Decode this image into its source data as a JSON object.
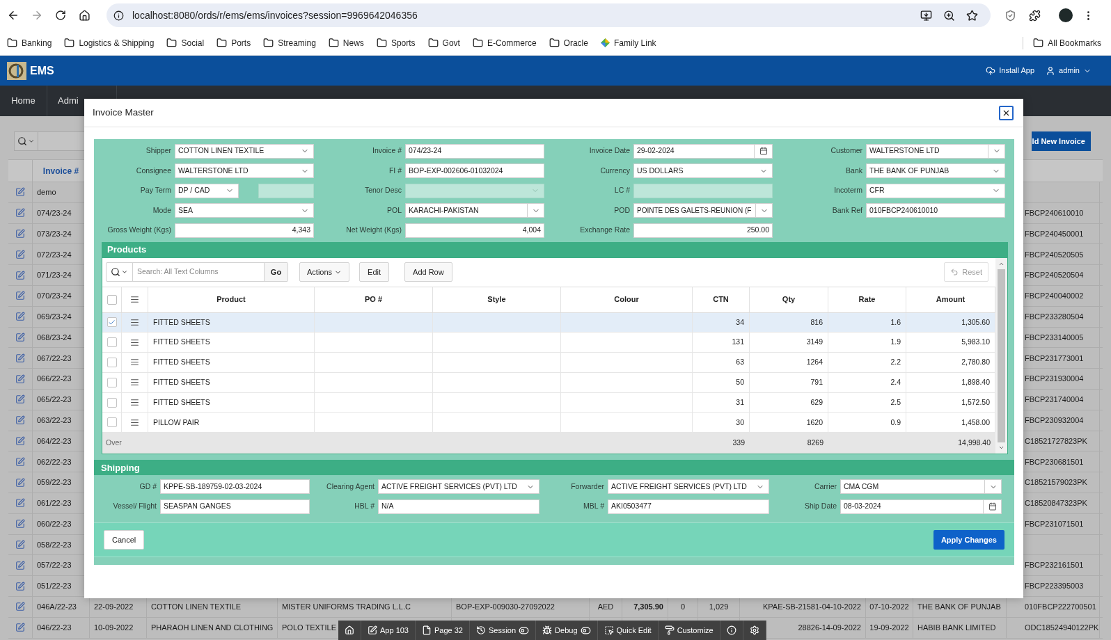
{
  "browser": {
    "url": "localhost:8080/ords/r/ems/ems/invoices?session=9969642046356",
    "bookmarks": [
      {
        "label": "Banking",
        "kind": "folder"
      },
      {
        "label": "Logistics & Shipping",
        "kind": "folder"
      },
      {
        "label": "Social",
        "kind": "folder"
      },
      {
        "label": "Ports",
        "kind": "folder"
      },
      {
        "label": "Streaming",
        "kind": "folder"
      },
      {
        "label": "News",
        "kind": "folder"
      },
      {
        "label": "Sports",
        "kind": "folder"
      },
      {
        "label": "Govt",
        "kind": "folder"
      },
      {
        "label": "E-Commerce",
        "kind": "folder"
      },
      {
        "label": "Oracle",
        "kind": "folder"
      },
      {
        "label": "Family Link",
        "kind": "link"
      }
    ],
    "all_bookmarks": "All Bookmarks"
  },
  "app_header": {
    "title": "EMS",
    "install": "Install App",
    "user": "admin"
  },
  "nav": {
    "items": [
      {
        "label": "Home"
      },
      {
        "label": "Admi"
      }
    ]
  },
  "page": {
    "add_button": "ld New Invoice",
    "table": {
      "header": "Invoice #",
      "rows": [
        {
          "invoice": "demo"
        },
        {
          "invoice": "074/23-24",
          "bank_ref": "FBCP240610010"
        },
        {
          "invoice": "073/23-24",
          "bank_ref": "FBCP240450001"
        },
        {
          "invoice": "072/23-24",
          "bank_ref": "FBCP240520505"
        },
        {
          "invoice": "071/23-24",
          "bank_ref": "FBCP240520504"
        },
        {
          "invoice": "070/23-24",
          "bank_ref": "FBCP240040002"
        },
        {
          "invoice": "069/23-24",
          "bank_ref": "FBCP233280504"
        },
        {
          "invoice": "068/23-24",
          "bank_ref": "FBCP233140005"
        },
        {
          "invoice": "067/22-23",
          "bank_ref": "FBCP231773001"
        },
        {
          "invoice": "066/22-23",
          "bank_ref": "FBCP231930004"
        },
        {
          "invoice": "065/22-23",
          "bank_ref": "FBCP231740004"
        },
        {
          "invoice": "063/22-23",
          "bank_ref": "FBCP230932004"
        },
        {
          "invoice": "064/22-23",
          "bank_ref": "C18521727823PK"
        },
        {
          "invoice": "062/22-23",
          "bank_ref": "FBCP230681501"
        },
        {
          "invoice": "059/22-23",
          "bank_ref": "C18521579023PK"
        },
        {
          "invoice": "061/22-23",
          "bank_ref": "C18520847323PK"
        },
        {
          "invoice": "060/22-23",
          "bank_ref": "FBCP231071501"
        },
        {
          "invoice": "058/22-23"
        },
        {
          "invoice": "057/22-23",
          "bank_ref": "FBCP232161501"
        },
        {
          "invoice": "051/22-23",
          "bank_ref": "FBCP223395003"
        },
        {
          "invoice": "046A/22-23",
          "date": "22-09-2022",
          "shipper": "COTTON LINEN TEXTILE",
          "consignee": "MISTER UNIFORMS TRADING L.L.C",
          "fi": "BOP-EXP-009030-27092022",
          "currency": "AED",
          "amount": "7,305.90",
          "column_8": "0",
          "column_9": "1,029",
          "gd": "KPAE-SB-21581-04-10-2022",
          "ship_date": "07-10-2022",
          "bank": "THE BANK OF PUNJAB",
          "bank_ref": "010FBCP222700501"
        },
        {
          "invoice": "046/22-23",
          "date": "10-09-2022",
          "shipper": "PHARAOH LINEN AND CLOTHING",
          "consignee": "POLO TEXTILE",
          "gd": "28826-14-09-2022",
          "ship_date": "19-09-2022",
          "bank": "HABIB BANK LIMITED",
          "bank_ref": "ODC18524940122PK"
        }
      ]
    }
  },
  "modal": {
    "title": "Invoice Master",
    "form": {
      "rows": [
        [
          {
            "label": "Shipper",
            "value": "COTTON LINEN TEXTILE",
            "kind": "select",
            "disabled": false
          },
          {
            "label": "Invoice #",
            "value": "074/23-24",
            "kind": "text",
            "disabled": false
          },
          {
            "label": "Invoice Date",
            "value": "29-02-2024",
            "kind": "date",
            "disabled": false
          },
          {
            "label": "Customer",
            "value": "WALTERSTONE LTD",
            "kind": "combo",
            "disabled": false
          }
        ],
        [
          {
            "label": "Consignee",
            "value": "WALTERSTONE LTD",
            "kind": "select",
            "disabled": false
          },
          {
            "label": "FI #",
            "value": "BOP-EXP-002606-01032024",
            "kind": "text",
            "disabled": false
          },
          {
            "label": "Currency",
            "value": "US DOLLARS",
            "kind": "select",
            "disabled": false
          },
          {
            "label": "Bank",
            "value": "THE BANK OF PUNJAB",
            "kind": "select",
            "disabled": false
          }
        ],
        [
          {
            "label": "Pay Term",
            "value": "DP / CAD",
            "kind": "select",
            "disabled": false,
            "extra_field": {
              "disabled": true
            }
          },
          {
            "label": "Tenor Desc",
            "kind": "select",
            "disabled": true
          },
          {
            "label": "LC #",
            "kind": "text",
            "disabled": true
          },
          {
            "label": "Incoterm",
            "value": "CFR",
            "kind": "select",
            "disabled": false
          }
        ],
        [
          {
            "label": "Mode",
            "value": "SEA",
            "kind": "select",
            "disabled": false
          },
          {
            "label": "POL",
            "value": "KARACHI-PAKISTAN",
            "kind": "combo",
            "disabled": false
          },
          {
            "label": "POD",
            "value": "POINTE DES GALETS-REUNION (F",
            "kind": "combo",
            "disabled": false
          },
          {
            "label": "Bank Ref",
            "value": "010FBCP240610010",
            "kind": "text",
            "disabled": false
          }
        ],
        [
          {
            "label": "Gross Weight (Kgs)",
            "value": "4,343",
            "kind": "number",
            "disabled": false
          },
          {
            "label": "Net Weight (Kgs)",
            "value": "4,004",
            "kind": "number",
            "disabled": false
          },
          {
            "label": "Exchange Rate",
            "value": "250.00",
            "kind": "number",
            "disabled": false
          }
        ]
      ]
    },
    "products": {
      "title": "Products",
      "search_placeholder": "Search: All Text Columns",
      "go": "Go",
      "actions": "Actions",
      "edit": "Edit",
      "add_row": "Add Row",
      "reset": "Reset",
      "all_selected": false,
      "columns": [
        "Product",
        "PO #",
        "Style",
        "Colour",
        "CTN",
        "Qty",
        "Rate",
        "Amount"
      ],
      "rows": [
        {
          "selected": true,
          "cells": [
            "FITTED SHEETS",
            null,
            null,
            null,
            "34",
            "816",
            "1.6",
            "1,305.60"
          ]
        },
        {
          "selected": false,
          "cells": [
            "FITTED SHEETS",
            null,
            null,
            null,
            "131",
            "3149",
            "1.9",
            "5,983.10"
          ]
        },
        {
          "selected": false,
          "cells": [
            "FITTED SHEETS",
            null,
            null,
            null,
            "63",
            "1264",
            "2.2",
            "2,780.80"
          ]
        },
        {
          "selected": false,
          "cells": [
            "FITTED SHEETS",
            null,
            null,
            null,
            "50",
            "791",
            "2.4",
            "1,898.40"
          ]
        },
        {
          "selected": false,
          "cells": [
            "FITTED SHEETS",
            null,
            null,
            null,
            "31",
            "629",
            "2.5",
            "1,572.50"
          ]
        },
        {
          "selected": false,
          "cells": [
            "PILLOW PAIR",
            null,
            null,
            null,
            "30",
            "1620",
            "0.9",
            "1,458.00"
          ]
        }
      ],
      "footer": {
        "label": "Over",
        "cells": [
          null,
          null,
          null,
          null,
          "339",
          "8269",
          null,
          "14,998.40"
        ]
      }
    },
    "shipping": {
      "title": "Shipping",
      "rows": [
        [
          {
            "label": "GD #",
            "value": "KPPE-SB-189759-02-03-2024",
            "kind": "text",
            "disabled": false
          },
          {
            "label": "Clearing Agent",
            "value": "ACTIVE FREIGHT SERVICES (PVT) LTD",
            "kind": "select",
            "disabled": false
          },
          {
            "label": "Forwarder",
            "value": "ACTIVE FREIGHT SERVICES (PVT) LTD",
            "kind": "select",
            "disabled": false
          },
          {
            "label": "Carrier",
            "value": "CMA CGM",
            "kind": "combo",
            "disabled": false
          }
        ],
        [
          {
            "label": "Vessel/ Flight",
            "value": "SEASPAN GANGES",
            "kind": "text",
            "disabled": false
          },
          {
            "label": "HBL #",
            "value": "N/A",
            "kind": "text",
            "disabled": false
          },
          {
            "label": "MBL #",
            "value": "AKI0503477",
            "kind": "text",
            "disabled": false
          },
          {
            "label": "Ship Date",
            "value": "08-03-2024",
            "kind": "date",
            "disabled": false
          }
        ]
      ]
    },
    "buttons": {
      "cancel": "Cancel",
      "apply": "Apply Changes"
    }
  },
  "dev_toolbar": [
    {
      "kind": "home",
      "toggle": false
    },
    {
      "kind": "app",
      "label": "App 103",
      "toggle": false
    },
    {
      "kind": "page",
      "label": "Page 32",
      "toggle": false
    },
    {
      "kind": "session",
      "label": "Session",
      "toggle": true
    },
    {
      "kind": "debug",
      "label": "Debug",
      "toggle": true
    },
    {
      "kind": "quick_edit",
      "label": "Quick Edit",
      "toggle": false
    },
    {
      "kind": "customize",
      "label": "Customize",
      "toggle": false
    },
    {
      "kind": "info",
      "toggle": false
    },
    {
      "kind": "settings",
      "toggle": false
    }
  ]
}
